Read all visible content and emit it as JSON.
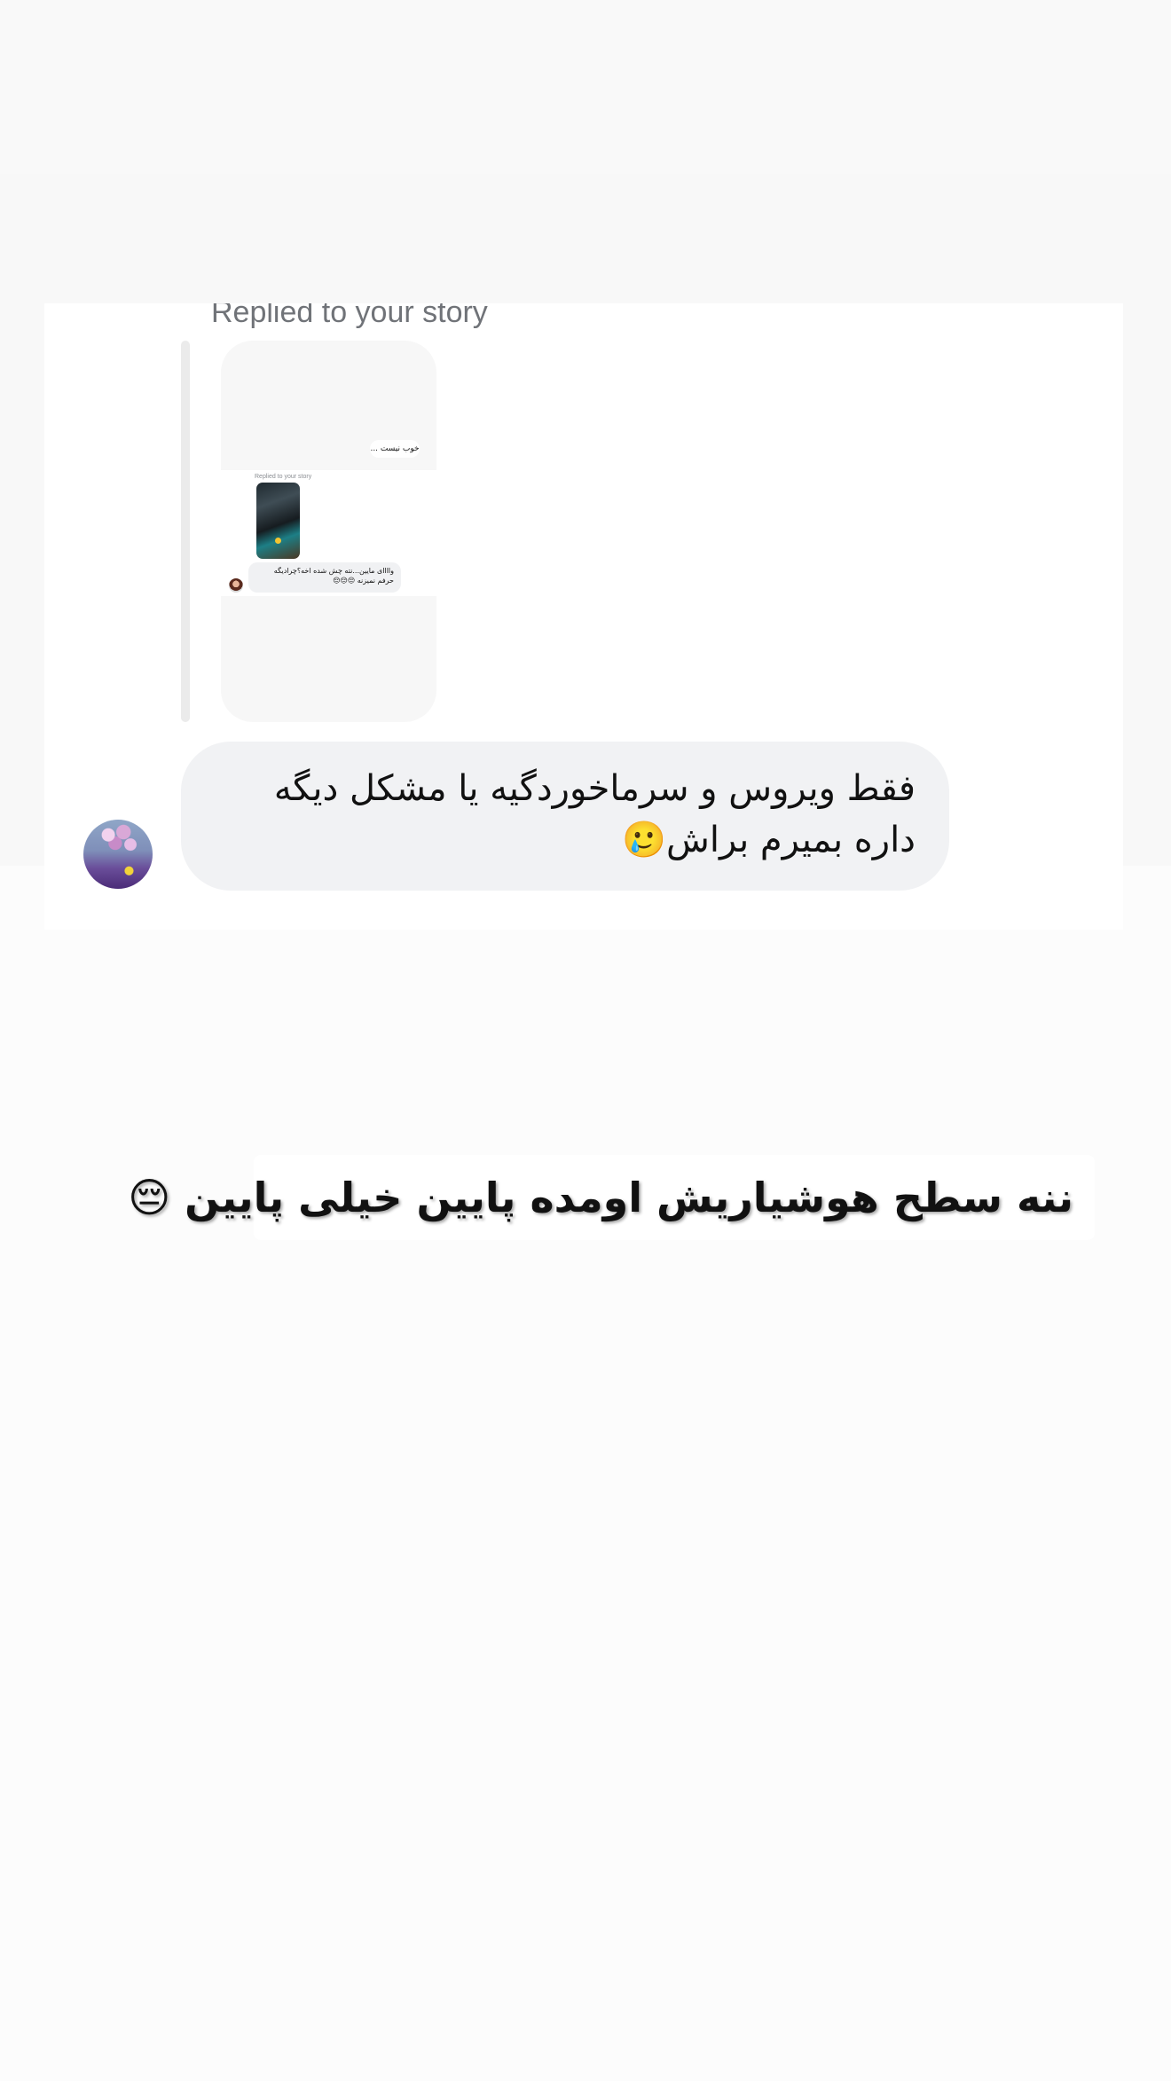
{
  "reply_header": {
    "label": "Replied to your story"
  },
  "story_preview": {
    "top_bubble_text": "خوب نیست ...",
    "replied_label": "Replied to your story",
    "message_text": "واااای مایین...نته چش شده اخه؟چرادیگه حرفم نمیزنه 😔😔😔"
  },
  "message": {
    "text": "فقط ویروس و سرماخوردگیه یا مشکل دیگه داره بمیرم براش🥲"
  },
  "caption": {
    "text": "ننه سطح هوشیاریش اومده پایین خیلی پایین 😔"
  }
}
